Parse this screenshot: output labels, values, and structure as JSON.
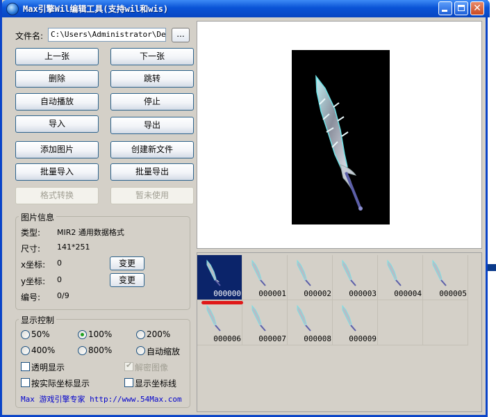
{
  "window": {
    "title": "Max引擎Wil编辑工具(支持wil和wis)"
  },
  "file": {
    "label": "文件名:",
    "value": "C:\\Users\\Administrator\\Desk",
    "browse_label": "..."
  },
  "buttons": {
    "prev": "上一张",
    "next": "下一张",
    "delete": "删除",
    "jump": "跳转",
    "autoplay": "自动播放",
    "stop": "停止",
    "import": "导入",
    "export": "导出",
    "add_image": "添加图片",
    "create_file": "创建新文件",
    "batch_import": "批量导入",
    "batch_export": "批量导出",
    "format_convert": "格式转换",
    "unused": "暂未使用"
  },
  "image_info": {
    "legend": "图片信息",
    "type_label": "类型:",
    "type_value": "MIR2  通用数据格式",
    "size_label": "尺寸:",
    "size_value": "141*251",
    "x_label": "x坐标:",
    "x_value": "0",
    "y_label": "y坐标:",
    "y_value": "0",
    "change_label": "变更",
    "index_label": "编号:",
    "index_value": "0/9"
  },
  "display": {
    "legend": "显示控制",
    "zoom_options": [
      {
        "label": "50%",
        "selected": false
      },
      {
        "label": "100%",
        "selected": true
      },
      {
        "label": "200%",
        "selected": false
      },
      {
        "label": "400%",
        "selected": false
      },
      {
        "label": "800%",
        "selected": false
      },
      {
        "label": "自动缩放",
        "selected": false
      }
    ],
    "transparent": {
      "label": "透明显示",
      "checked": false
    },
    "decrypt": {
      "label": "解密图像",
      "checked": true,
      "disabled": true
    },
    "actual_coords": {
      "label": "按实际坐标显示",
      "checked": false
    },
    "coord_lines": {
      "label": "显示坐标线",
      "checked": false
    }
  },
  "footer": {
    "text": "Max 游戏引擎专家  http://www.54Max.com"
  },
  "thumbnails": [
    "000000",
    "000001",
    "000002",
    "000003",
    "000004",
    "000005",
    "000006",
    "000007",
    "000008",
    "000009"
  ],
  "selected_thumbnail": "000000",
  "colors": {
    "title_bar": "#0a53d6",
    "panel": "#d4d0c8",
    "selected_thumb": "#0b246a",
    "link": "#0000cc",
    "highlight_mark": "#e01818"
  }
}
